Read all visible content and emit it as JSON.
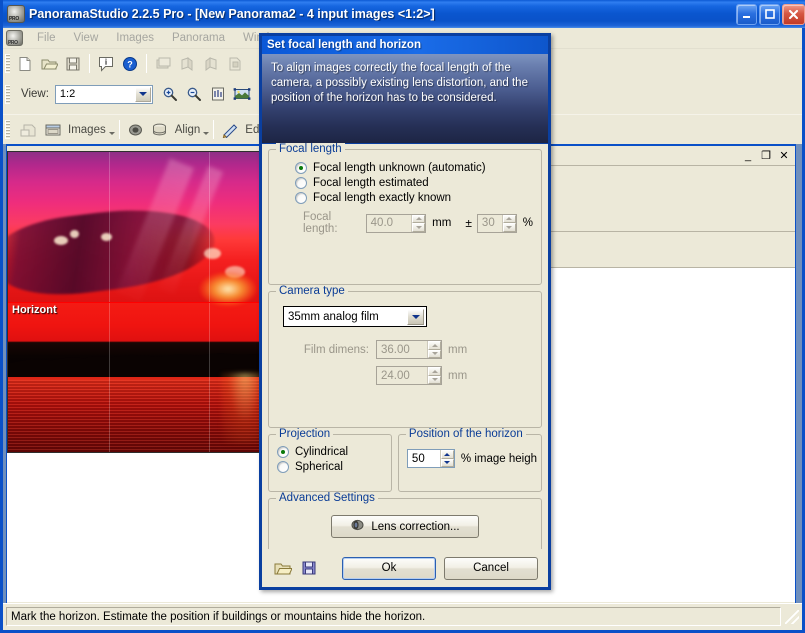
{
  "window": {
    "title": "PanoramaStudio 2.2.5 Pro - [New Panorama2 - 4 input images <1:2>]",
    "icon": "app-icon",
    "minimize": "_",
    "maximize": "□",
    "close": "✕"
  },
  "menubar": {
    "items": [
      {
        "label": "File"
      },
      {
        "label": "View"
      },
      {
        "label": "Images"
      },
      {
        "label": "Panorama"
      },
      {
        "label": "Window"
      }
    ]
  },
  "toolbar1": {
    "icons": [
      "new-document-icon",
      "open-folder-icon",
      "save-icon",
      "info-icon",
      "help-icon",
      "import-images-icon",
      "rotate-left-icon",
      "rotate-right-icon",
      "flip-icon"
    ]
  },
  "toolbar2": {
    "view_label": "View:",
    "view_value": "1:2",
    "icons": [
      "zoom-in-icon",
      "zoom-out-icon",
      "fit-window-icon",
      "full-view-icon"
    ]
  },
  "toolbar3": {
    "buttons": [
      {
        "label": "",
        "icon": "printer-icon",
        "has_arrow": false
      },
      {
        "label": "Images",
        "icon": "images-icon",
        "has_arrow": true
      },
      {
        "label": "",
        "icon": "lens-icon",
        "has_arrow": false
      },
      {
        "label": "Align",
        "icon": "align-icon",
        "has_arrow": true
      },
      {
        "label": "Ed",
        "icon": "edit-icon",
        "has_arrow": false
      }
    ]
  },
  "child_window": {
    "minimize": "_",
    "restore": "❐",
    "close": "✕"
  },
  "preview": {
    "horizon_label": "Horizont"
  },
  "statusbar": {
    "message": "Mark the horizon. Estimate the position if buildings or mountains hide the horizon."
  },
  "dialog": {
    "title": "Set focal length and horizon",
    "banner_text": "To align images correctly the focal length of the camera, a possibly existing lens distortion, and the position of the horizon has to be considered.",
    "focal_length": {
      "legend": "Focal length",
      "options": [
        {
          "label": "Focal length unknown (automatic)",
          "checked": true
        },
        {
          "label": "Focal length estimated",
          "checked": false
        },
        {
          "label": "Focal length exactly known",
          "checked": false
        }
      ],
      "field_label": "Focal length:",
      "value": "40.0",
      "unit": "mm",
      "plusminus": "±",
      "tolerance": "30",
      "tolerance_unit": "%"
    },
    "camera_type": {
      "legend": "Camera type",
      "selected": "35mm analog film",
      "dimension_label": "Film dimens:",
      "width": "36.00",
      "height": "24.00",
      "unit": "mm"
    },
    "projection": {
      "legend": "Projection",
      "options": [
        {
          "label": "Cylindrical",
          "checked": true
        },
        {
          "label": "Spherical",
          "checked": false
        }
      ]
    },
    "horizon": {
      "legend": "Position of the horizon",
      "value": "50",
      "unit": "% image heigh"
    },
    "advanced": {
      "legend": "Advanced Settings",
      "lens_button": "Lens correction...",
      "lens_icon": "lens-icon"
    },
    "footer": {
      "load_icon": "open-folder-icon",
      "save_icon": "save-icon",
      "ok": "Ok",
      "cancel": "Cancel"
    }
  },
  "colors": {
    "titlebar_blue": "#0a56cf",
    "dialog_border": "#0a3fa0",
    "group_legend": "#0a3c96",
    "window_face": "#ece9d8",
    "mdi_background": "#6f8fbc",
    "radio_dot": "#0a7a0a",
    "horizon_line": "#ff0000"
  }
}
